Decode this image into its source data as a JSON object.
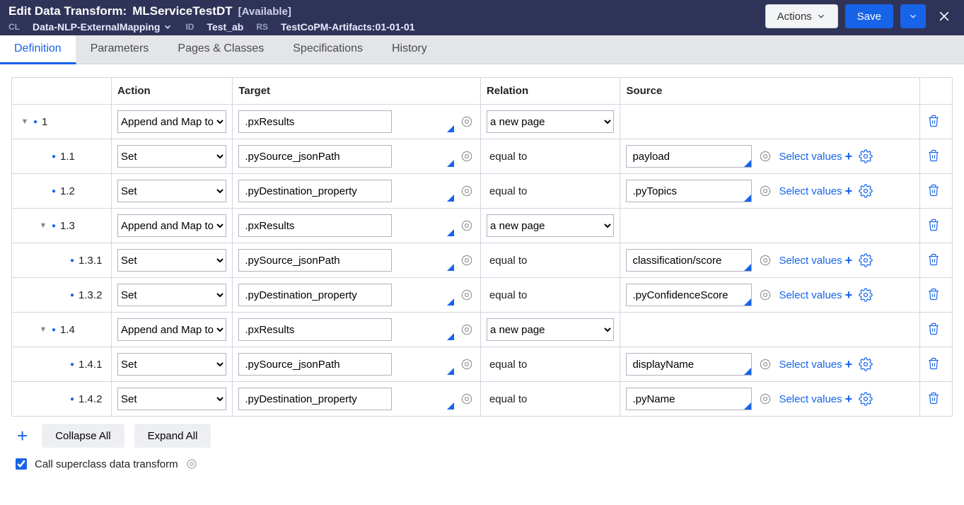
{
  "header": {
    "prefix": "Edit  Data Transform:",
    "name": "MLServiceTestDT",
    "status": "[Available]",
    "cl_label": "CL",
    "cl": "Data-NLP-ExternalMapping",
    "id_label": "ID",
    "id": "Test_ab",
    "rs_label": "RS",
    "rs": "TestCoPM-Artifacts:01-01-01",
    "actions_btn": "Actions",
    "save_btn": "Save"
  },
  "tabs": [
    "Definition",
    "Parameters",
    "Pages & Classes",
    "Specifications",
    "History"
  ],
  "activeTab": 0,
  "columns": {
    "action": "Action",
    "target": "Target",
    "relation": "Relation",
    "source": "Source"
  },
  "relationOptions": [
    "a new page",
    "equal to"
  ],
  "actionOptions": [
    "Append and Map to",
    "Set"
  ],
  "rows": [
    {
      "indent": 0,
      "expand": true,
      "num": "1",
      "action": "Append and Map to",
      "target": ".pxResults",
      "relationSelect": "a new page",
      "source": null,
      "selectValues": false,
      "gear": false
    },
    {
      "indent": 1,
      "expand": false,
      "num": "1.1",
      "action": "Set",
      "target": ".pySource_jsonPath",
      "relationStatic": "equal to",
      "source": "payload",
      "selectValues": true,
      "gear": true
    },
    {
      "indent": 1,
      "expand": false,
      "num": "1.2",
      "action": "Set",
      "target": ".pyDestination_property",
      "relationStatic": "equal to",
      "source": ".pyTopics",
      "selectValues": true,
      "gear": true
    },
    {
      "indent": 1,
      "expand": true,
      "num": "1.3",
      "action": "Append and Map to",
      "target": ".pxResults",
      "relationSelect": "a new page",
      "source": null,
      "selectValues": false,
      "gear": false
    },
    {
      "indent": 2,
      "expand": false,
      "num": "1.3.1",
      "action": "Set",
      "target": ".pySource_jsonPath",
      "relationStatic": "equal to",
      "source": "classification/score",
      "selectValues": true,
      "gear": true
    },
    {
      "indent": 2,
      "expand": false,
      "num": "1.3.2",
      "action": "Set",
      "target": ".pyDestination_property",
      "relationStatic": "equal to",
      "source": ".pyConfidenceScore",
      "selectValues": true,
      "gear": true
    },
    {
      "indent": 1,
      "expand": true,
      "num": "1.4",
      "action": "Append and Map to",
      "target": ".pxResults",
      "relationSelect": "a new page",
      "source": null,
      "selectValues": false,
      "gear": false
    },
    {
      "indent": 2,
      "expand": false,
      "num": "1.4.1",
      "action": "Set",
      "target": ".pySource_jsonPath",
      "relationStatic": "equal to",
      "source": "displayName",
      "selectValues": true,
      "gear": true
    },
    {
      "indent": 2,
      "expand": false,
      "num": "1.4.2",
      "action": "Set",
      "target": ".pyDestination_property",
      "relationStatic": "equal to",
      "source": ".pyName",
      "selectValues": true,
      "gear": true
    }
  ],
  "footer": {
    "collapse": "Collapse All",
    "expand": "Expand All",
    "super_label": "Call superclass data transform",
    "super_checked": true,
    "select_values_label": "Select values"
  }
}
